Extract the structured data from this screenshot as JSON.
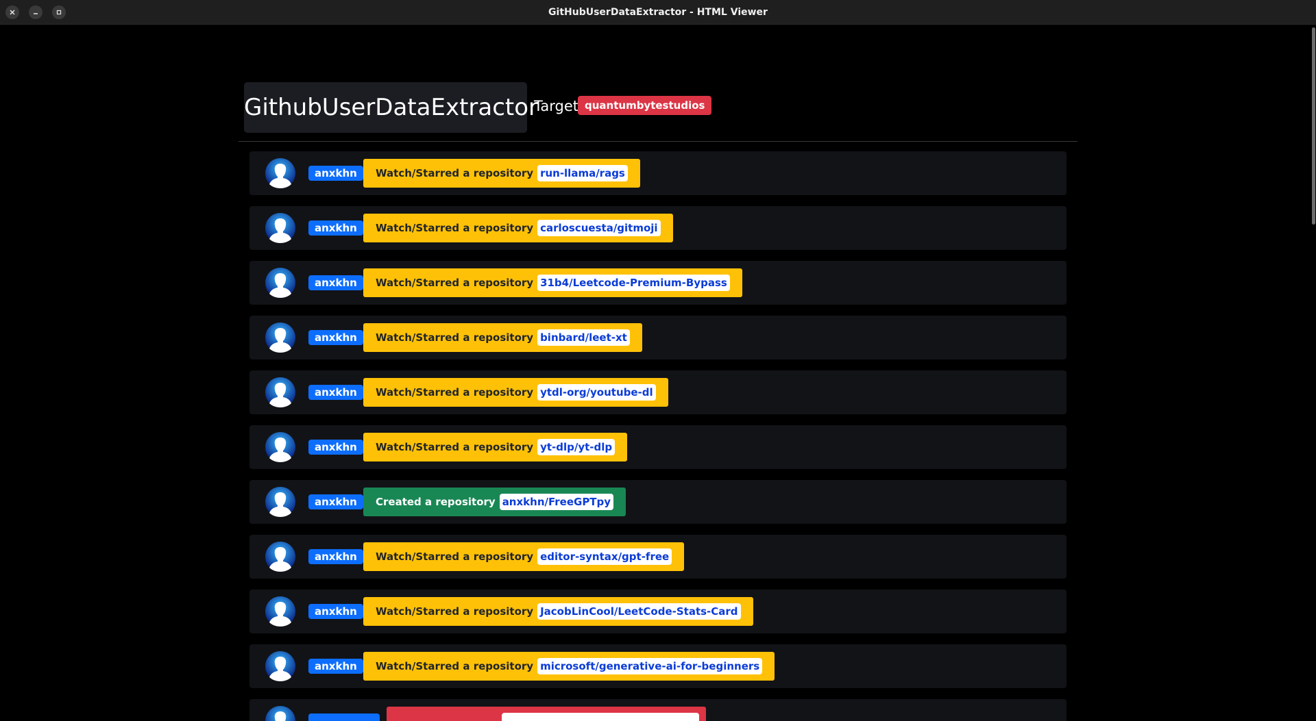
{
  "window": {
    "title": "GitHubUserDataExtractor - HTML Viewer",
    "close_icon": "close-icon",
    "minimize_icon": "minimize-icon",
    "maximize_icon": "maximize-icon"
  },
  "header": {
    "app_title": "GithubUserDataExtractor",
    "target_label": "Target",
    "target_value": "quantumbytestudios"
  },
  "colors": {
    "watch": "#ffc107",
    "created": "#198754",
    "fork": "#dc3545",
    "user_badge": "#0d6efd",
    "target_badge": "#dc3545"
  },
  "feed": [
    {
      "user": "anxkhn",
      "type": "watch",
      "action": "Watch/Starred a repository",
      "repo": "run-llama/rags"
    },
    {
      "user": "anxkhn",
      "type": "watch",
      "action": "Watch/Starred a repository",
      "repo": "carloscuesta/gitmoji"
    },
    {
      "user": "anxkhn",
      "type": "watch",
      "action": "Watch/Starred a repository",
      "repo": "31b4/Leetcode-Premium-Bypass"
    },
    {
      "user": "anxkhn",
      "type": "watch",
      "action": "Watch/Starred a repository",
      "repo": "binbard/leet-xt"
    },
    {
      "user": "anxkhn",
      "type": "watch",
      "action": "Watch/Starred a repository",
      "repo": "ytdl-org/youtube-dl"
    },
    {
      "user": "anxkhn",
      "type": "watch",
      "action": "Watch/Starred a repository",
      "repo": "yt-dlp/yt-dlp"
    },
    {
      "user": "anxkhn",
      "type": "created",
      "action": "Created a repository",
      "repo": "anxkhn/FreeGPTpy"
    },
    {
      "user": "anxkhn",
      "type": "watch",
      "action": "Watch/Starred a repository",
      "repo": "editor-syntax/gpt-free"
    },
    {
      "user": "anxkhn",
      "type": "watch",
      "action": "Watch/Starred a repository",
      "repo": "JacobLinCool/LeetCode-Stats-Card"
    },
    {
      "user": "anxkhn",
      "type": "watch",
      "action": "Watch/Starred a repository",
      "repo": "microsoft/generative-ai-for-beginners"
    }
  ]
}
